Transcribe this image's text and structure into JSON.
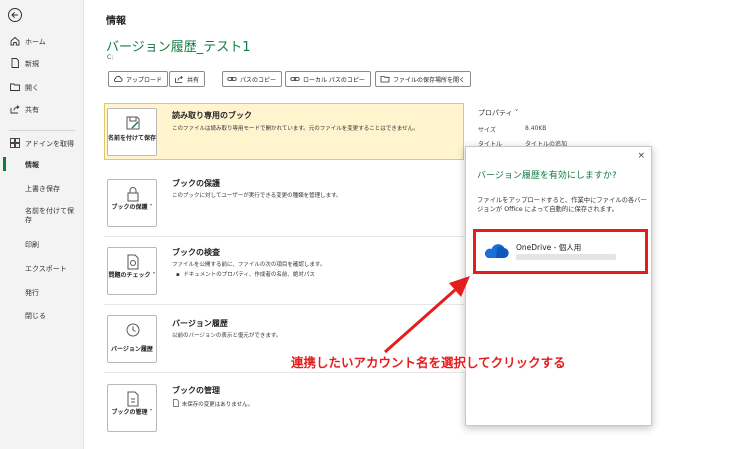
{
  "sidebar": {
    "items": [
      {
        "label": "ホーム"
      },
      {
        "label": "新規"
      },
      {
        "label": "開く"
      },
      {
        "label": "共有"
      },
      {
        "label": "アドインを取得"
      },
      {
        "label": "情報"
      },
      {
        "label": "上書き保存"
      },
      {
        "label": "名前を付けて保存"
      },
      {
        "label": "印刷"
      },
      {
        "label": "エクスポート"
      },
      {
        "label": "発行"
      },
      {
        "label": "閉じる"
      }
    ]
  },
  "main": {
    "page_title": "情報",
    "file_title": "バージョン履歴_テスト1",
    "file_path": "C:",
    "toolbar": [
      {
        "label": "アップロード"
      },
      {
        "label": "共有"
      },
      {
        "label": "パスのコピー"
      },
      {
        "label": "ローカル パスのコピー"
      },
      {
        "label": "ファイルの保存場所を開く"
      }
    ],
    "cards": [
      {
        "button": "名前を付けて保存",
        "title": "読み取り専用のブック",
        "desc": "このファイルは読み取り専用モードで開かれています。元のファイルを変更することはできません。"
      },
      {
        "button": "ブックの保護 ˅",
        "title": "ブックの保護",
        "desc": "このブックに対してユーザーが実行できる変更の種類を管理します。"
      },
      {
        "button": "問題のチェック ˅",
        "title": "ブックの検査",
        "desc": "ファイルを公開する前に、ファイルの次の項目を確認します。",
        "bullet": "ドキュメントのプロパティ、作成者の名前、絶対パス"
      },
      {
        "button": "バージョン履歴",
        "title": "バージョン履歴",
        "desc": "以前のバージョンの表示と復元ができます。"
      },
      {
        "button": "ブックの管理 ˅",
        "title": "ブックの管理",
        "desc": "未保存の変更はありません。"
      }
    ]
  },
  "properties": {
    "header": "プロパティ ˅",
    "rows": [
      {
        "key": "サイズ",
        "value": "8.40KB"
      },
      {
        "key": "タイトル",
        "value": "タイトルの追加"
      }
    ]
  },
  "dialog": {
    "close": "×",
    "title": "バージョン履歴を有効にしますか?",
    "text": "ファイルをアップロードすると、作業中にファイルの各バージョンが Office によって自動的に保存されます。",
    "account_name": "OneDrive - 個人用"
  },
  "annotation": "連携したいアカウント名を選択してクリックする",
  "colors": {
    "accent": "#107c41",
    "annotation_red": "#e51d1d",
    "highlight_bg": "#fff4ce"
  }
}
